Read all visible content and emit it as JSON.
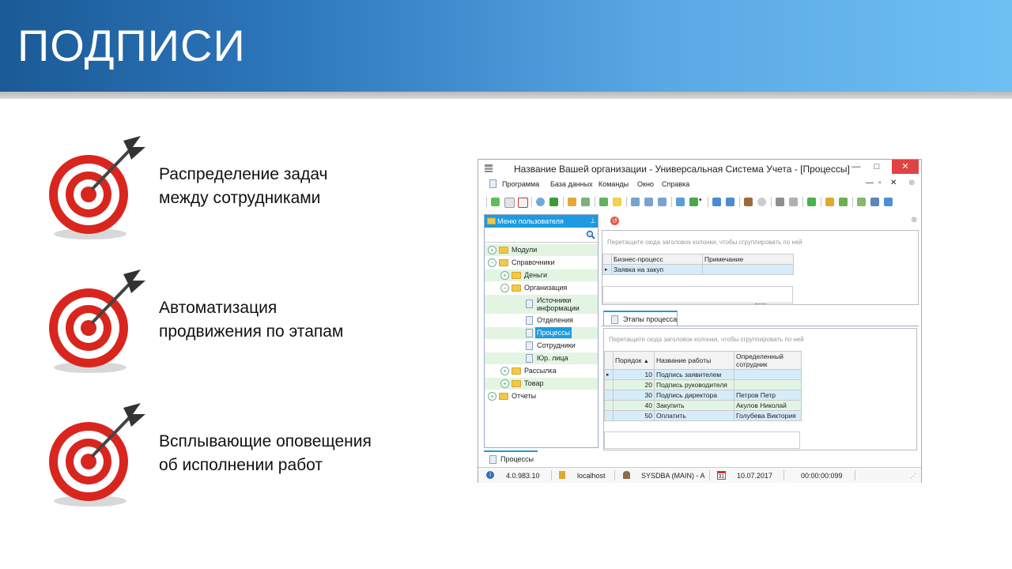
{
  "slide": {
    "title": "ПОДПИСИ",
    "features": [
      {
        "line1": "Распределение задач",
        "line2": "между сотрудниками",
        "icon": "target-icon"
      },
      {
        "line1": "Автоматизация",
        "line2": "продвижения по этапам",
        "icon": "target-icon"
      },
      {
        "line1": "Всплывающие оповещения",
        "line2": "об исполнении работ",
        "icon": "target-icon"
      }
    ]
  },
  "window": {
    "title": "Название Вашей организации - Универсальная Система Учета - [Процессы]",
    "controls": {
      "minimize": "—",
      "maximize": "□",
      "close": "✕"
    },
    "menu": [
      "Программа",
      "База данных",
      "Команды",
      "Окно",
      "Справка"
    ],
    "left_panel": {
      "header": "Меню пользователя",
      "tree": [
        {
          "label": "Модули",
          "level": 0,
          "expander": "+",
          "kind": "folder"
        },
        {
          "label": "Справочники",
          "level": 0,
          "expander": "−",
          "kind": "folder"
        },
        {
          "label": "Деньги",
          "level": 1,
          "expander": "+",
          "kind": "folder"
        },
        {
          "label": "Организация",
          "level": 1,
          "expander": "−",
          "kind": "folder"
        },
        {
          "label": "Источники",
          "label2": "информации",
          "level": 2,
          "kind": "doc"
        },
        {
          "label": "Отделения",
          "level": 2,
          "kind": "doc"
        },
        {
          "label": "Процессы",
          "level": 2,
          "kind": "doc",
          "selected": true
        },
        {
          "label": "Сотрудники",
          "level": 2,
          "kind": "doc"
        },
        {
          "label": "Юр. лица",
          "level": 2,
          "kind": "doc"
        },
        {
          "label": "Рассылка",
          "level": 1,
          "expander": "+",
          "kind": "folder"
        },
        {
          "label": "Товар",
          "level": 1,
          "expander": "+",
          "kind": "folder"
        },
        {
          "label": "Отчеты",
          "level": 0,
          "expander": "+",
          "kind": "folder"
        }
      ]
    },
    "top_grid": {
      "group_hint": "Перетащите сюда заголовок колонки, чтобы сгруппировать по ней",
      "columns": [
        "Бизнес-процесс",
        "Примечание"
      ],
      "rows": [
        [
          "Заявка на закуп",
          ""
        ]
      ]
    },
    "detail_tab": "Этапы процесса",
    "bottom_grid": {
      "group_hint": "Перетащите сюда заголовок колонки, чтобы сгруппировать по ней",
      "columns": [
        "Порядок",
        "Название работы",
        "Определенный",
        "сотрудник"
      ],
      "rows": [
        [
          "10",
          "Подпись заявителем",
          ""
        ],
        [
          "20",
          "Подпись руководителя",
          ""
        ],
        [
          "30",
          "Подпись директора",
          "Петров Петр"
        ],
        [
          "40",
          "Закупить",
          "Акулов Николай"
        ],
        [
          "50",
          "Оплатить",
          "Голубева Виктория"
        ]
      ]
    },
    "doc_tab": "Процессы",
    "status": {
      "version": "4.0.983.10",
      "server": "localhost",
      "user": "SYSDBA (MAIN) - A",
      "date": "10.07.2017",
      "timer": "00:00:00:099",
      "calendar_day": "31"
    }
  }
}
